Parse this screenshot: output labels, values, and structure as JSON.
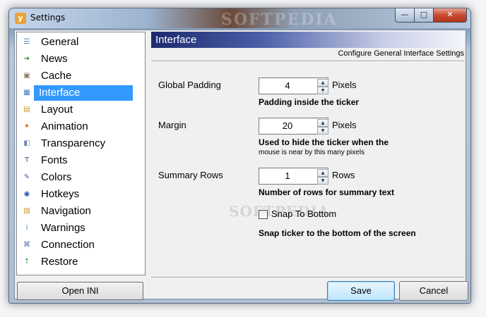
{
  "window": {
    "title": "Settings",
    "app_icon_glyph": "y",
    "title_watermark": "SOFTPEDIA",
    "controls": {
      "minimize": "—",
      "maximize": "□",
      "close": "✕"
    }
  },
  "sidebar": {
    "items": [
      {
        "label": "General",
        "icon": "general-icon",
        "color": "#4a7fc1",
        "glyph": "☰"
      },
      {
        "label": "News",
        "icon": "news-arrow-icon",
        "color": "#2e8b2e",
        "glyph": "➔"
      },
      {
        "label": "Cache",
        "icon": "cache-icon",
        "color": "#8c7a5a",
        "glyph": "▣"
      },
      {
        "label": "Interface",
        "icon": "interface-icon",
        "color": "#3a78c8",
        "glyph": "▦",
        "selected": true
      },
      {
        "label": "Layout",
        "icon": "layout-icon",
        "color": "#c89a2a",
        "glyph": "▤"
      },
      {
        "label": "Animation",
        "icon": "animation-icon",
        "color": "#e06a1a",
        "glyph": "✦"
      },
      {
        "label": "Transparency",
        "icon": "transparency-icon",
        "color": "#6a8ab8",
        "glyph": "◧"
      },
      {
        "label": "Fonts",
        "icon": "fonts-icon",
        "color": "#4a4a8a",
        "glyph": "T"
      },
      {
        "label": "Colors",
        "icon": "colors-icon",
        "color": "#3a5ac8",
        "glyph": "✎"
      },
      {
        "label": "Hotkeys",
        "icon": "hotkeys-icon",
        "color": "#2a5aa8",
        "glyph": "◉"
      },
      {
        "label": "Navigation",
        "icon": "navigation-icon",
        "color": "#c89a2a",
        "glyph": "▧"
      },
      {
        "label": "Warnings",
        "icon": "warnings-icon",
        "color": "#2a78c8",
        "glyph": "i"
      },
      {
        "label": "Connection",
        "icon": "connection-icon",
        "color": "#4a6a9a",
        "glyph": "⌘"
      },
      {
        "label": "Restore",
        "icon": "restore-icon",
        "color": "#2a9a3a",
        "glyph": "↑"
      }
    ],
    "open_ini_label": "Open INI"
  },
  "panel": {
    "header": "Interface",
    "subheader": "Configure General Interface Settings",
    "global_padding": {
      "label": "Global Padding",
      "value": "4",
      "unit": "Pixels",
      "hint": "Padding inside the ticker"
    },
    "margin": {
      "label": "Margin",
      "value": "20",
      "unit": "Pixels",
      "hint": "Used to hide the ticker when the",
      "hint_small": "mouse is near by this many pixels"
    },
    "summary_rows": {
      "label": "Summary Rows",
      "value": "1",
      "unit": "Rows",
      "hint": "Number of rows for summary text"
    },
    "snap": {
      "label": "Snap To Bottom",
      "checked": false,
      "hint": "Snap ticker to the bottom of the screen"
    },
    "watermark": "SOFTPEDIA"
  },
  "buttons": {
    "save": "Save",
    "cancel": "Cancel"
  }
}
